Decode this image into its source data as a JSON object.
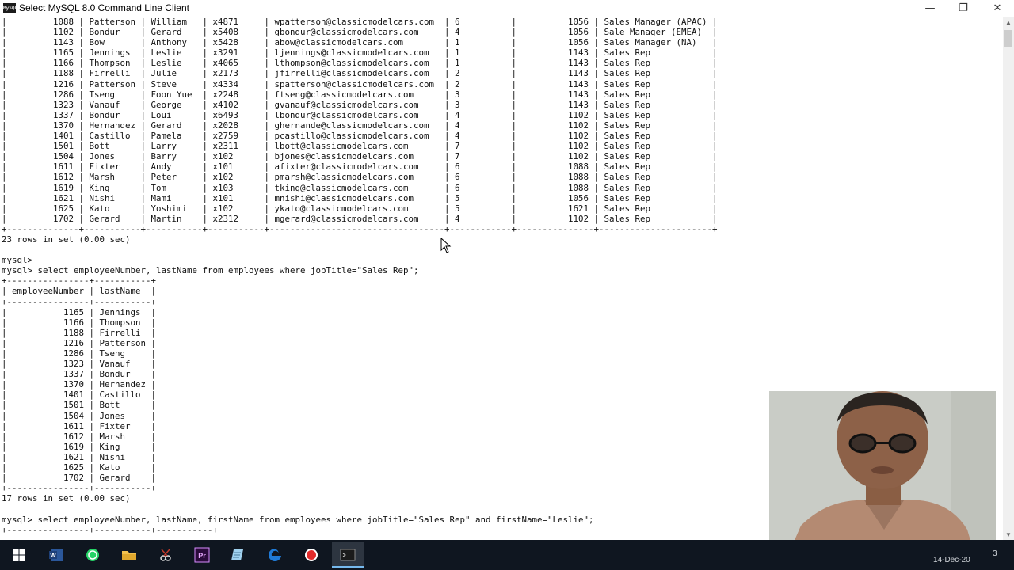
{
  "window": {
    "title": "Select MySQL 8.0 Command Line Client",
    "icon_label": "MySQL",
    "minimize_glyph": "—",
    "restore_glyph": "❐",
    "close_glyph": "✕"
  },
  "console": {
    "lines": [
      "|         1088 | Patterson | William   | x4871     | wpatterson@classicmodelcars.com  | 6          |          1056 | Sales Manager (APAC) |",
      "|         1102 | Bondur    | Gerard    | x5408     | gbondur@classicmodelcars.com     | 4          |          1056 | Sale Manager (EMEA)  |",
      "|         1143 | Bow       | Anthony   | x5428     | abow@classicmodelcars.com        | 1          |          1056 | Sales Manager (NA)   |",
      "|         1165 | Jennings  | Leslie    | x3291     | ljennings@classicmodelcars.com   | 1          |          1143 | Sales Rep            |",
      "|         1166 | Thompson  | Leslie    | x4065     | lthompson@classicmodelcars.com   | 1          |          1143 | Sales Rep            |",
      "|         1188 | Firrelli  | Julie     | x2173     | jfirrelli@classicmodelcars.com   | 2          |          1143 | Sales Rep            |",
      "|         1216 | Patterson | Steve     | x4334     | spatterson@classicmodelcars.com  | 2          |          1143 | Sales Rep            |",
      "|         1286 | Tseng     | Foon Yue  | x2248     | ftseng@classicmodelcars.com      | 3          |          1143 | Sales Rep            |",
      "|         1323 | Vanauf    | George    | x4102     | gvanauf@classicmodelcars.com     | 3          |          1143 | Sales Rep            |",
      "|         1337 | Bondur    | Loui      | x6493     | lbondur@classicmodelcars.com     | 4          |          1102 | Sales Rep            |",
      "|         1370 | Hernandez | Gerard    | x2028     | ghernande@classicmodelcars.com   | 4          |          1102 | Sales Rep            |",
      "|         1401 | Castillo  | Pamela    | x2759     | pcastillo@classicmodelcars.com   | 4          |          1102 | Sales Rep            |",
      "|         1501 | Bott      | Larry     | x2311     | lbott@classicmodelcars.com       | 7          |          1102 | Sales Rep            |",
      "|         1504 | Jones     | Barry     | x102      | bjones@classicmodelcars.com      | 7          |          1102 | Sales Rep            |",
      "|         1611 | Fixter    | Andy      | x101      | afixter@classicmodelcars.com     | 6          |          1088 | Sales Rep            |",
      "|         1612 | Marsh     | Peter     | x102      | pmarsh@classicmodelcars.com      | 6          |          1088 | Sales Rep            |",
      "|         1619 | King      | Tom       | x103      | tking@classicmodelcars.com       | 6          |          1088 | Sales Rep            |",
      "|         1621 | Nishi     | Mami      | x101      | mnishi@classicmodelcars.com      | 5          |          1056 | Sales Rep            |",
      "|         1625 | Kato      | Yoshimi   | x102      | ykato@classicmodelcars.com       | 5          |          1621 | Sales Rep            |",
      "|         1702 | Gerard    | Martin    | x2312     | mgerard@classicmodelcars.com     | 4          |          1102 | Sales Rep            |",
      "+--------------+-----------+-----------+-----------+----------------------------------+------------+---------------+----------------------+",
      "23 rows in set (0.00 sec)",
      "",
      "mysql>",
      "mysql> select employeeNumber, lastName from employees where jobTitle=\"Sales Rep\";",
      "+----------------+-----------+",
      "| employeeNumber | lastName  |",
      "+----------------+-----------+",
      "|           1165 | Jennings  |",
      "|           1166 | Thompson  |",
      "|           1188 | Firrelli  |",
      "|           1216 | Patterson |",
      "|           1286 | Tseng     |",
      "|           1323 | Vanauf    |",
      "|           1337 | Bondur    |",
      "|           1370 | Hernandez |",
      "|           1401 | Castillo  |",
      "|           1501 | Bott      |",
      "|           1504 | Jones     |",
      "|           1611 | Fixter    |",
      "|           1612 | Marsh     |",
      "|           1619 | King      |",
      "|           1621 | Nishi     |",
      "|           1625 | Kato      |",
      "|           1702 | Gerard    |",
      "+----------------+-----------+",
      "17 rows in set (0.00 sec)",
      "",
      "mysql> select employeeNumber, lastName, firstName from employees where jobTitle=\"Sales Rep\" and firstName=\"Leslie\";",
      "+----------------+-----------+-----------+"
    ]
  },
  "taskbar": {
    "apps": [
      {
        "name": "windows-start-icon",
        "color": "#ffffff"
      },
      {
        "name": "word-icon",
        "color": "#2b579a"
      },
      {
        "name": "whatsapp-icon",
        "color": "#25d366"
      },
      {
        "name": "file-explorer-icon",
        "color": "#f2c14e"
      },
      {
        "name": "snipping-tool-icon",
        "color": "#e2e2e2"
      },
      {
        "name": "premiere-icon",
        "color": "#2a0a3a"
      },
      {
        "name": "notepad-icon",
        "color": "#9fd0ee"
      },
      {
        "name": "edge-icon",
        "color": "#1f7ad6"
      },
      {
        "name": "record-icon",
        "color": "#e22b2b"
      },
      {
        "name": "mysql-console-icon",
        "color": "#1b1b1b"
      }
    ],
    "clock_date": "14-Dec-20",
    "tray_extra": "3"
  }
}
